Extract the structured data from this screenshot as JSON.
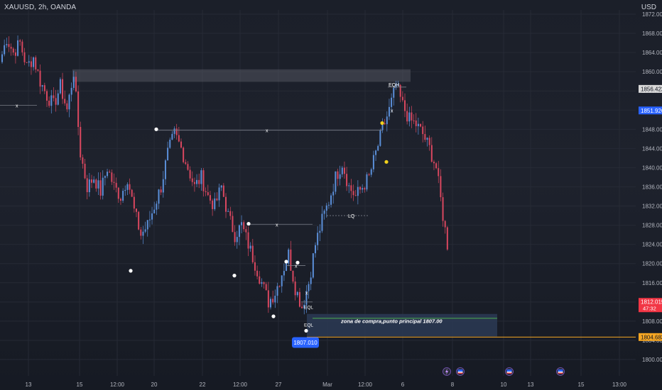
{
  "symbol_title": "XAUUSD, 2h, OANDA",
  "currency": "USD",
  "colors": {
    "up": "#5b8fd9",
    "down": "#d9475f",
    "grid": "#262a35",
    "axis_text": "#b2b5be",
    "level_line": "#7a7e88",
    "zone": "#2b3a55",
    "supply_zone": "#5d606b",
    "swing_marker": "#ffffff",
    "signal_marker": "#f2d21c",
    "line_orange": "#f5a623",
    "line_green": "#4caf50"
  },
  "price_badges": [
    {
      "value": "1856.422",
      "price": 1856.422,
      "bg": "#d9d9d9",
      "fg": "#131722"
    },
    {
      "value": "1851.926",
      "price": 1851.926,
      "bg": "#2962ff",
      "fg": "#ffffff"
    },
    {
      "value": "1812.015",
      "sub": "47:32",
      "price": 1812.015,
      "bg": "#f23645",
      "fg": "#ffffff"
    },
    {
      "value": "1804.683",
      "price": 1804.683,
      "bg": "#f5a623",
      "fg": "#131722"
    }
  ],
  "event_icons": [
    {
      "name": "lightning-event-icon",
      "x": 629
    },
    {
      "name": "flag-event-icon",
      "x": 648
    },
    {
      "name": "flag-event-icon",
      "x": 717
    },
    {
      "name": "flag-event-icon",
      "x": 789
    }
  ],
  "chart_data": {
    "type": "candlestick",
    "title": "XAUUSD, 2h, OANDA",
    "ylabel": "USD",
    "ylim": [
      1796,
      1874
    ],
    "grid": true,
    "y_ticks": [
      1872,
      1868,
      1864,
      1860,
      1856,
      1852,
      1848,
      1844,
      1840,
      1836,
      1832,
      1828,
      1824,
      1820,
      1816,
      1812,
      1808,
      1804,
      1800
    ],
    "y_tick_labels": [
      "1872.000",
      "1868.000",
      "1864.000",
      "1860.000",
      "1856.000",
      "1852.000",
      "1848.000",
      "1844.000",
      "1840.000",
      "1836.000",
      "1832.000",
      "1828.000",
      "1824.000",
      "1820.000",
      "1816.000",
      "1812.000",
      "1808.000",
      "1804.000",
      "1800.000"
    ],
    "x_tick_labels": [
      "13",
      "15",
      "12:00",
      "20",
      "22",
      "12:00",
      "27",
      "Mar",
      "12:00",
      "6",
      "8",
      "10",
      "13",
      "15",
      "13:00"
    ],
    "close_path": [
      1862,
      1867,
      1864,
      1866,
      1861,
      1863,
      1858,
      1855,
      1853,
      1857,
      1852,
      1860,
      1843,
      1836,
      1838,
      1835,
      1840,
      1836,
      1834,
      1838,
      1831,
      1826,
      1828,
      1832,
      1836,
      1843,
      1847,
      1844,
      1840,
      1836,
      1838,
      1834,
      1832,
      1836,
      1830,
      1826,
      1828,
      1824,
      1820,
      1816,
      1812,
      1814,
      1818,
      1822,
      1815,
      1811,
      1816,
      1824,
      1829,
      1833,
      1838,
      1841,
      1836,
      1834,
      1836,
      1838,
      1843,
      1848,
      1852,
      1857,
      1853,
      1850,
      1849,
      1847,
      1844,
      1840,
      1830,
      1821,
      1816,
      1812
    ],
    "annotations": {
      "buy_zone_label": "zona de compra,punto principal 1807.00",
      "buy_zone_price": "1807.010",
      "eqh_label": "EQH",
      "eql_label": "EQL",
      "lq_label": "LQ",
      "x_marker": "x"
    }
  }
}
